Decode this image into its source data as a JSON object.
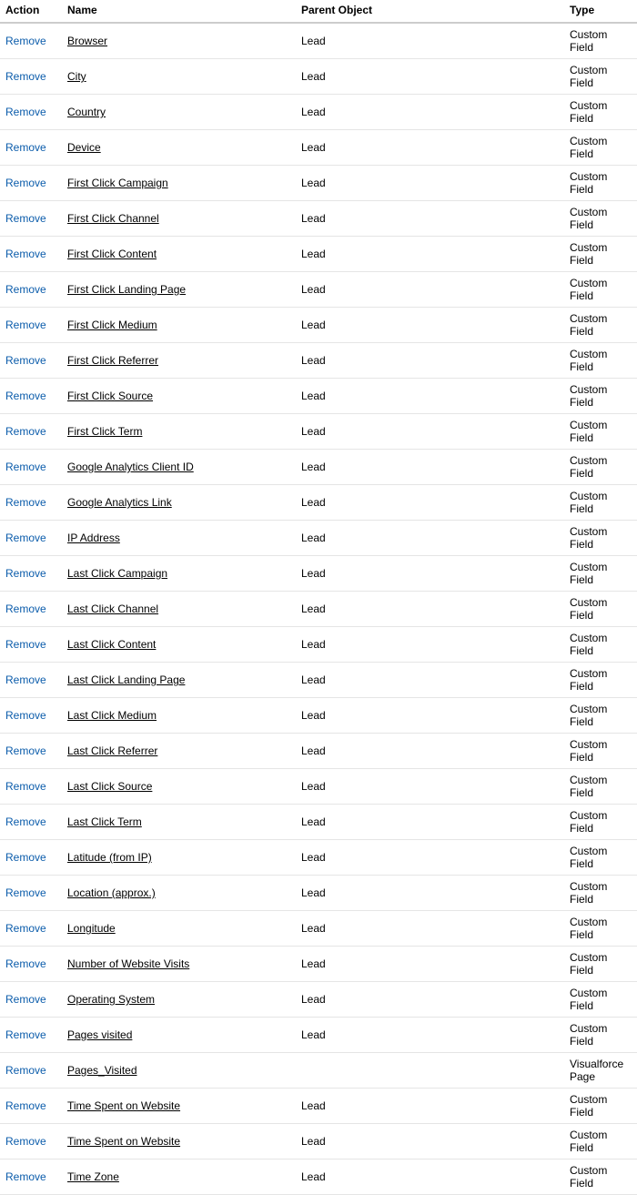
{
  "columns": {
    "action": "Action",
    "name": "Name",
    "parent": "Parent Object",
    "type": "Type"
  },
  "action_label": "Remove",
  "rows": [
    {
      "name": "Browser",
      "parent": "Lead",
      "type": "Custom Field"
    },
    {
      "name": "City",
      "parent": "Lead",
      "type": "Custom Field"
    },
    {
      "name": "Country",
      "parent": "Lead",
      "type": "Custom Field"
    },
    {
      "name": "Device",
      "parent": "Lead",
      "type": "Custom Field"
    },
    {
      "name": "First Click Campaign",
      "parent": "Lead",
      "type": "Custom Field"
    },
    {
      "name": "First Click Channel",
      "parent": "Lead",
      "type": "Custom Field"
    },
    {
      "name": "First Click Content",
      "parent": "Lead",
      "type": "Custom Field"
    },
    {
      "name": "First Click Landing Page",
      "parent": "Lead",
      "type": "Custom Field"
    },
    {
      "name": "First Click Medium",
      "parent": "Lead",
      "type": "Custom Field"
    },
    {
      "name": "First Click Referrer",
      "parent": "Lead",
      "type": "Custom Field"
    },
    {
      "name": "First Click Source",
      "parent": "Lead",
      "type": "Custom Field"
    },
    {
      "name": "First Click Term",
      "parent": "Lead",
      "type": "Custom Field"
    },
    {
      "name": "Google Analytics Client ID",
      "parent": "Lead",
      "type": "Custom Field"
    },
    {
      "name": "Google Analytics Link",
      "parent": "Lead",
      "type": "Custom Field"
    },
    {
      "name": "IP Address",
      "parent": "Lead",
      "type": "Custom Field"
    },
    {
      "name": "Last Click Campaign",
      "parent": "Lead",
      "type": "Custom Field"
    },
    {
      "name": "Last Click Channel",
      "parent": "Lead",
      "type": "Custom Field"
    },
    {
      "name": "Last Click Content",
      "parent": "Lead",
      "type": "Custom Field"
    },
    {
      "name": "Last Click Landing Page",
      "parent": "Lead",
      "type": "Custom Field"
    },
    {
      "name": "Last Click Medium",
      "parent": "Lead",
      "type": "Custom Field"
    },
    {
      "name": "Last Click Referrer",
      "parent": "Lead",
      "type": "Custom Field"
    },
    {
      "name": "Last Click Source",
      "parent": "Lead",
      "type": "Custom Field"
    },
    {
      "name": "Last Click Term",
      "parent": "Lead",
      "type": "Custom Field"
    },
    {
      "name": "Latitude (from IP)",
      "parent": "Lead",
      "type": "Custom Field"
    },
    {
      "name": "Location (approx.)",
      "parent": "Lead",
      "type": "Custom Field"
    },
    {
      "name": "Longitude",
      "parent": "Lead",
      "type": "Custom Field"
    },
    {
      "name": "Number of Website Visits",
      "parent": "Lead",
      "type": "Custom Field"
    },
    {
      "name": "Operating System",
      "parent": "Lead",
      "type": "Custom Field"
    },
    {
      "name": "Pages visited",
      "parent": "Lead",
      "type": "Custom Field"
    },
    {
      "name": "Pages_Visited",
      "parent": "",
      "type": "Visualforce Page"
    },
    {
      "name": "Time Spent on Website",
      "parent": "Lead",
      "type": "Custom Field"
    },
    {
      "name": "Time Spent on Website",
      "parent": "Lead",
      "type": "Custom Field"
    },
    {
      "name": "Time Zone",
      "parent": "Lead",
      "type": "Custom Field"
    }
  ]
}
